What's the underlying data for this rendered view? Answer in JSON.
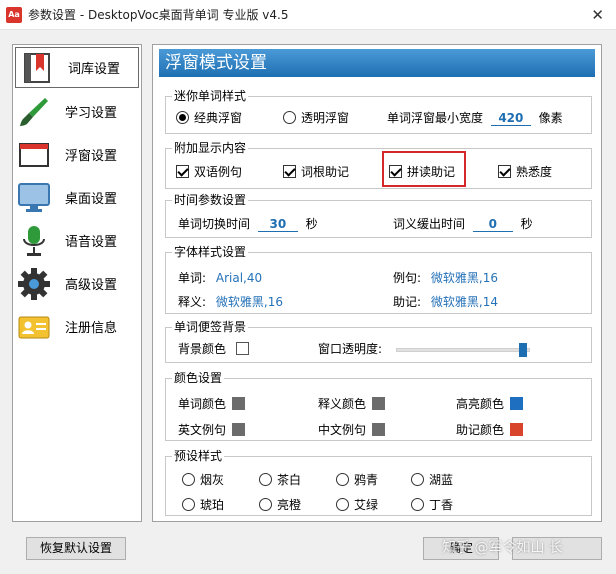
{
  "window": {
    "title": "参数设置 - DesktopVoc桌面背单词 专业版 v4.5",
    "app_icon_text": "Aa",
    "close_glyph": "✕"
  },
  "sidebar": {
    "items": [
      {
        "label": "词库设置",
        "icon": "bookmark-book-icon"
      },
      {
        "label": "学习设置",
        "icon": "paintbrush-icon"
      },
      {
        "label": "浮窗设置",
        "icon": "window-icon"
      },
      {
        "label": "桌面设置",
        "icon": "monitor-icon"
      },
      {
        "label": "语音设置",
        "icon": "microphone-icon"
      },
      {
        "label": "高级设置",
        "icon": "gear-icon"
      },
      {
        "label": "注册信息",
        "icon": "id-card-icon"
      }
    ]
  },
  "panel": {
    "header": "浮窗模式设置",
    "mini_style": {
      "title": "迷你单词样式",
      "option_classic": "经典浮窗",
      "option_transparent": "透明浮窗",
      "min_width_label": "单词浮窗最小宽度",
      "min_width_value": "420",
      "min_width_unit": "像素"
    },
    "extra_display": {
      "title": "附加显示内容",
      "items": [
        "双语例句",
        "词根助记",
        "拼读助记",
        "熟悉度"
      ]
    },
    "time_params": {
      "title": "时间参数设置",
      "switch_label": "单词切换时间",
      "switch_value": "30",
      "switch_unit": "秒",
      "delay_label": "词义缓出时间",
      "delay_value": "0",
      "delay_unit": "秒"
    },
    "font_style": {
      "title": "字体样式设置",
      "word_label": "单词:",
      "word_value": "Arial,40",
      "example_label": "例句:",
      "example_value": "微软雅黑,16",
      "meaning_label": "释义:",
      "meaning_value": "微软雅黑,16",
      "mnemonic_label": "助记:",
      "mnemonic_value": "微软雅黑,14"
    },
    "note_bg": {
      "title": "单词便签背景",
      "bg_color_label": "背景颜色",
      "opacity_label": "窗口透明度:",
      "opacity_fraction": 0.98
    },
    "colors": {
      "title": "颜色设置",
      "items": [
        {
          "label": "单词颜色",
          "color": "#6b6b6b"
        },
        {
          "label": "释义颜色",
          "color": "#6b6b6b"
        },
        {
          "label": "高亮颜色",
          "color": "#1f6fc0"
        },
        {
          "label": "英文例句",
          "color": "#6b6b6b"
        },
        {
          "label": "中文例句",
          "color": "#6b6b6b"
        },
        {
          "label": "助记颜色",
          "color": "#d9452c"
        }
      ]
    },
    "presets": {
      "title": "预设样式",
      "items": [
        "烟灰",
        "茶白",
        "鸦青",
        "湖蓝",
        "琥珀",
        "亮橙",
        "艾绿",
        "丁香"
      ]
    }
  },
  "footer": {
    "restore_button": "恢复默认设置",
    "right_button": "确定"
  },
  "watermark": "知乎 @军令如山 长"
}
